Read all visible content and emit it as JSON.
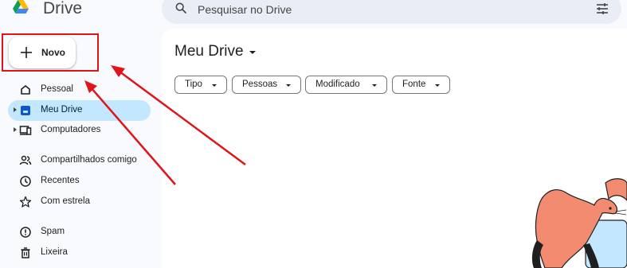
{
  "app": {
    "name": "Drive"
  },
  "search": {
    "placeholder": "Pesquisar no Drive"
  },
  "new_button": {
    "label": "Novo"
  },
  "sidebar": {
    "items": [
      {
        "label": "Pessoal",
        "icon": "home-icon"
      },
      {
        "label": "Meu Drive",
        "icon": "drive-icon",
        "active": true
      },
      {
        "label": "Computadores",
        "icon": "computer-icon"
      },
      {
        "label": "Compartilhados comigo",
        "icon": "shared-icon"
      },
      {
        "label": "Recentes",
        "icon": "clock-icon"
      },
      {
        "label": "Com estrela",
        "icon": "star-icon"
      },
      {
        "label": "Spam",
        "icon": "spam-icon"
      },
      {
        "label": "Lixeira",
        "icon": "trash-icon"
      }
    ]
  },
  "main": {
    "title": "Meu Drive",
    "filters": [
      {
        "label": "Tipo"
      },
      {
        "label": "Pessoas"
      },
      {
        "label": "Modificado"
      },
      {
        "label": "Fonte"
      }
    ]
  },
  "colors": {
    "active_nav": "#c2e7ff",
    "highlight": "#e0141b",
    "background": "#f8fafd"
  }
}
